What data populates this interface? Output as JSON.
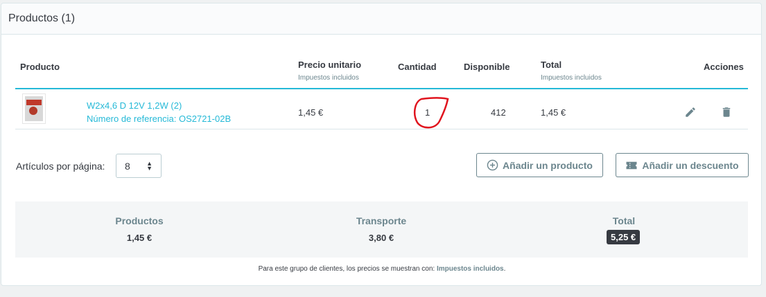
{
  "card": {
    "title": "Productos (1)"
  },
  "table": {
    "headers": {
      "product": "Producto",
      "unit_price": "Precio unitario",
      "unit_price_sub": "Impuestos incluidos",
      "quantity": "Cantidad",
      "available": "Disponible",
      "total": "Total",
      "total_sub": "Impuestos incluidos",
      "actions": "Acciones"
    },
    "rows": [
      {
        "name": "W2x4,6 D 12V 1,2W (2)",
        "reference": "Número de referencia: OS2721-02B",
        "unit_price": "1,45 €",
        "quantity": "1",
        "available": "412",
        "total": "1,45 €"
      }
    ]
  },
  "controls": {
    "per_page_label": "Artículos por página:",
    "per_page_value": "8",
    "add_product": "Añadir un producto",
    "add_discount": "Añadir un descuento"
  },
  "summary": {
    "products_label": "Productos",
    "products_value": "1,45 €",
    "shipping_label": "Transporte",
    "shipping_value": "3,80 €",
    "total_label": "Total",
    "total_value": "5,25 €"
  },
  "footnote": {
    "prefix": "Para este grupo de clientes, los precios se muestran con: ",
    "emphasis": "Impuestos incluidos",
    "suffix": "."
  },
  "icons": {
    "edit": "pencil-icon",
    "delete": "trash-icon",
    "add": "plus-circle-icon",
    "discount": "ticket-icon",
    "annotation_color": "#e0141e"
  }
}
